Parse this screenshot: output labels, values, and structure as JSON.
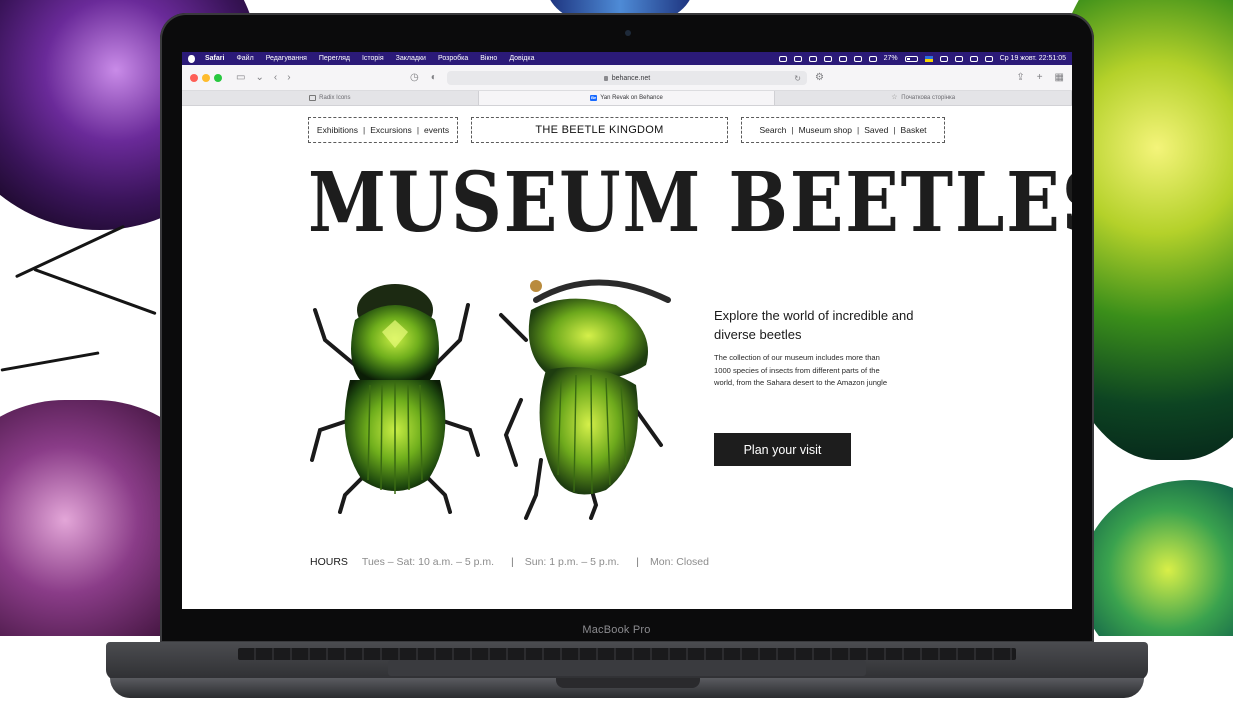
{
  "menubar": {
    "items": [
      "Safari",
      "Файл",
      "Редагування",
      "Перегляд",
      "Історія",
      "Закладки",
      "Розробка",
      "Вікно",
      "Довідка"
    ],
    "battery": "27%",
    "clock": "Ср 19 жовт.  22:51:05"
  },
  "browser": {
    "url": "behance.net",
    "tabs": [
      {
        "label": "Radix Icons",
        "active": false
      },
      {
        "label": "Yan Revak on Behance",
        "active": true
      },
      {
        "label": "Початкова сторінка",
        "active": false
      }
    ]
  },
  "site": {
    "nav_left": [
      "Exhibitions",
      "Excursions",
      "events"
    ],
    "brand": "THE BEETLE KINGDOM",
    "nav_right": [
      "Search",
      "Museum shop",
      "Saved",
      "Basket"
    ],
    "headline": "MUSEUM BEETLES",
    "intro_title": "Explore the world of incredible and diverse beetles",
    "intro_body": "The collection of our museum includes more than 1000 species of insects from different parts of the world, from the Sahara desert to the Amazon jungle",
    "cta": "Plan your visit",
    "hours": {
      "label": "HOURS",
      "entries": [
        "Tues – Sat: 10 a.m. – 5 p.m.",
        "Sun: 1 p.m. – 5 p.m.",
        "Mon: Closed"
      ]
    }
  },
  "device_label": "MacBook Pro",
  "colors": {
    "menubar": "#2b1a78",
    "cta_bg": "#1d1d1d",
    "beetle_green": "#7fc41f"
  }
}
